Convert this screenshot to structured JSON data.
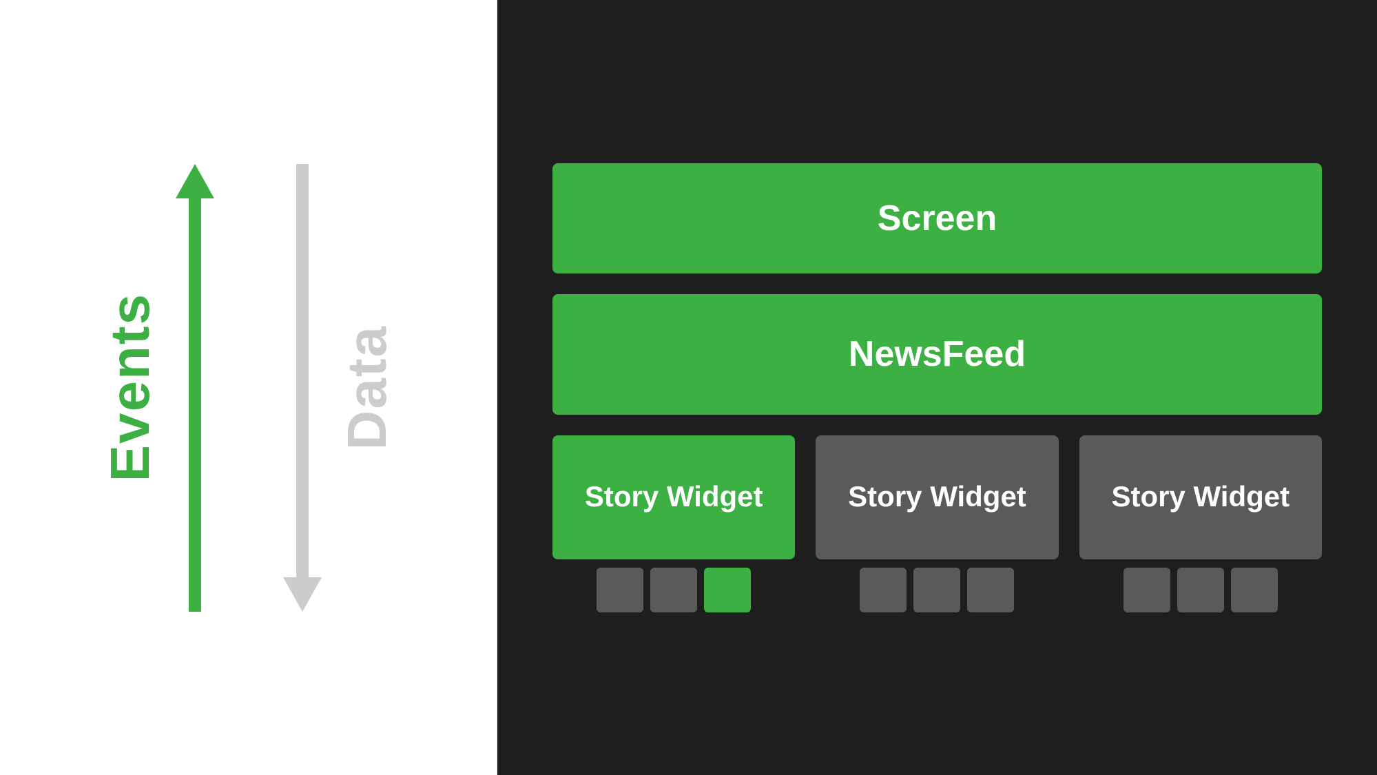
{
  "left_panel": {
    "events_label": "Events",
    "data_label": "Data"
  },
  "right_panel": {
    "screen_label": "Screen",
    "newsfeed_label": "NewsFeed",
    "story_widgets": [
      {
        "label": "Story Widget",
        "color": "green",
        "sub_blocks": [
          {
            "color": "grey"
          },
          {
            "color": "grey"
          },
          {
            "color": "green"
          }
        ]
      },
      {
        "label": "Story Widget",
        "color": "grey",
        "sub_blocks": [
          {
            "color": "grey"
          },
          {
            "color": "grey"
          },
          {
            "color": "grey"
          }
        ]
      },
      {
        "label": "Story Widget",
        "color": "grey",
        "sub_blocks": [
          {
            "color": "grey"
          },
          {
            "color": "grey"
          },
          {
            "color": "grey"
          }
        ]
      }
    ]
  },
  "colors": {
    "green": "#3cb043",
    "grey": "#5a5a5a",
    "white": "#ffffff",
    "dark_bg": "#1e1e1e",
    "light_grey_arrow": "#cccccc"
  }
}
